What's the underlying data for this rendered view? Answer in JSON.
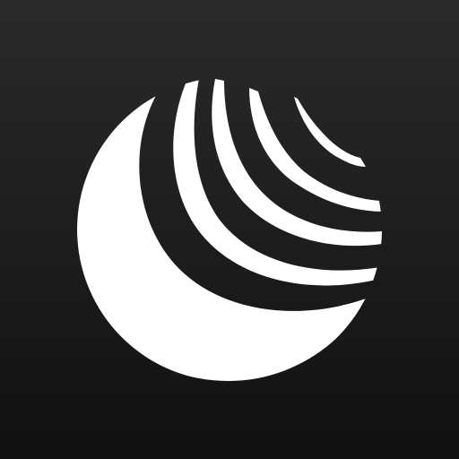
{
  "icon": {
    "name": "crescent-arcs-logo-icon",
    "background_top": "#2a2a2a",
    "background_bottom": "#111111",
    "mark_color": "#ffffff"
  }
}
